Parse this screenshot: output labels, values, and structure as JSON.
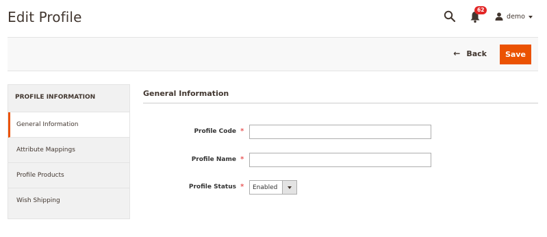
{
  "header": {
    "title": "Edit Profile",
    "notifications_count": "62",
    "user_name": "demo"
  },
  "actions": {
    "back_label": "Back",
    "save_label": "Save"
  },
  "sidebar": {
    "title": "PROFILE INFORMATION",
    "tabs": [
      {
        "label": "General Information",
        "active": true
      },
      {
        "label": "Attribute Mappings",
        "active": false
      },
      {
        "label": "Profile Products",
        "active": false
      },
      {
        "label": "Wish Shipping",
        "active": false
      }
    ]
  },
  "form": {
    "section_title": "General Information",
    "fields": {
      "profile_code": {
        "label": "Profile Code",
        "value": ""
      },
      "profile_name": {
        "label": "Profile Name",
        "value": ""
      },
      "profile_status": {
        "label": "Profile Status",
        "value": "Enabled"
      }
    },
    "required_mark": "*"
  },
  "colors": {
    "accent": "#eb5202",
    "badge": "#e22626",
    "text": "#41362f"
  }
}
